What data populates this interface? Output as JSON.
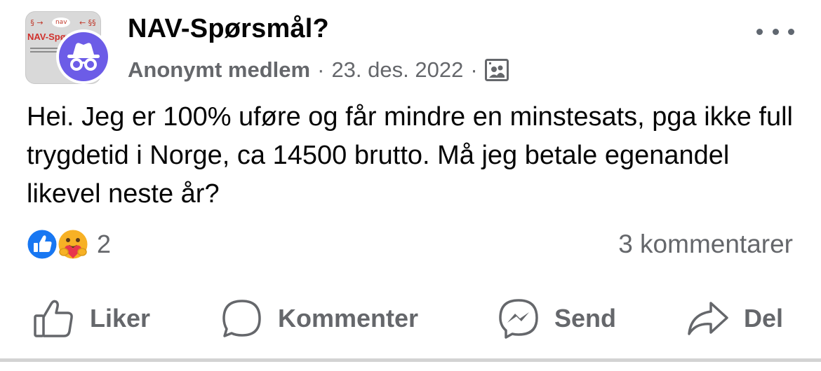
{
  "post": {
    "group_name": "NAV-Spørsmål?",
    "author": "Anonymt medlem",
    "separator": "·",
    "date": "23. des. 2022",
    "audience_icon": "group-members-icon",
    "body": "Hei. Jeg er 100% uføre og får mindre en minstesats, pga ikke full trygdetid i Norge, ca 14500 brutto. Må jeg betale egenandel likevel neste år?"
  },
  "group_thumbnail": {
    "title": "NAV-Spør",
    "badge": "nav"
  },
  "reactions": {
    "icons": [
      "like-reaction-icon",
      "care-reaction-icon"
    ],
    "count": "2"
  },
  "comments": {
    "label": "3 kommentarer"
  },
  "actions": {
    "like": "Liker",
    "comment": "Kommenter",
    "send": "Send",
    "share": "Del"
  },
  "colors": {
    "like_blue": "#1877f2",
    "anon_purple": "#6c5ce7",
    "secondary_text": "#65676b"
  }
}
